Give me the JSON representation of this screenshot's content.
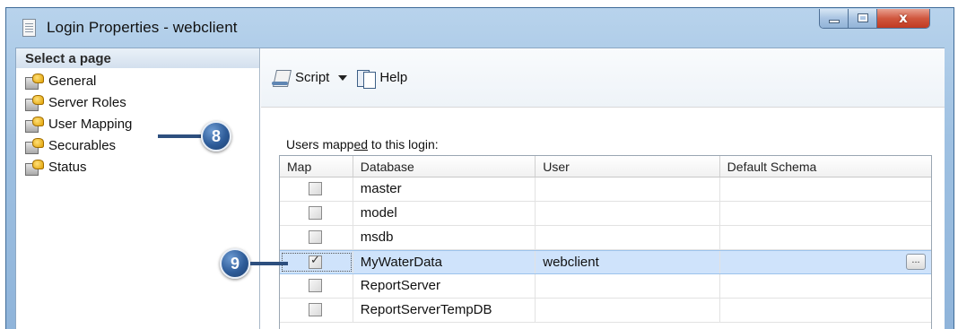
{
  "window": {
    "title": "Login Properties - webclient",
    "controls": {
      "minimize": "minimize",
      "maximize": "maximize",
      "close": "x"
    }
  },
  "left_pane": {
    "header": "Select a page",
    "pages": [
      {
        "label": "General",
        "icon": "page-key-icon"
      },
      {
        "label": "Server Roles",
        "icon": "page-key-icon"
      },
      {
        "label": "User Mapping",
        "icon": "page-key-icon"
      },
      {
        "label": "Securables",
        "icon": "page-key-icon"
      },
      {
        "label": "Status",
        "icon": "page-key-icon"
      }
    ]
  },
  "toolbar": {
    "script_label": "Script",
    "help_label": "Help"
  },
  "mapping": {
    "label_pre": "Users mapp",
    "label_accel": "ed",
    "label_post": " to this login:",
    "columns": [
      "Map",
      "Database",
      "User",
      "Default Schema"
    ],
    "rows": [
      {
        "map": false,
        "database": "master",
        "user": "",
        "schema": ""
      },
      {
        "map": false,
        "database": "model",
        "user": "",
        "schema": ""
      },
      {
        "map": false,
        "database": "msdb",
        "user": "",
        "schema": ""
      },
      {
        "map": true,
        "database": "MyWaterData",
        "user": "webclient",
        "schema": "",
        "selected": true,
        "ellipsis": "..."
      },
      {
        "map": false,
        "database": "ReportServer",
        "user": "",
        "schema": ""
      },
      {
        "map": false,
        "database": "ReportServerTempDB",
        "user": "",
        "schema": ""
      }
    ]
  },
  "callouts": [
    {
      "label": "8"
    },
    {
      "label": "9"
    }
  ],
  "colors": {
    "title_bar": "#9fc1e2",
    "selected_row": "#cfe3fb",
    "callout_badge": "#2e5c99",
    "close_button": "#c13a22"
  }
}
